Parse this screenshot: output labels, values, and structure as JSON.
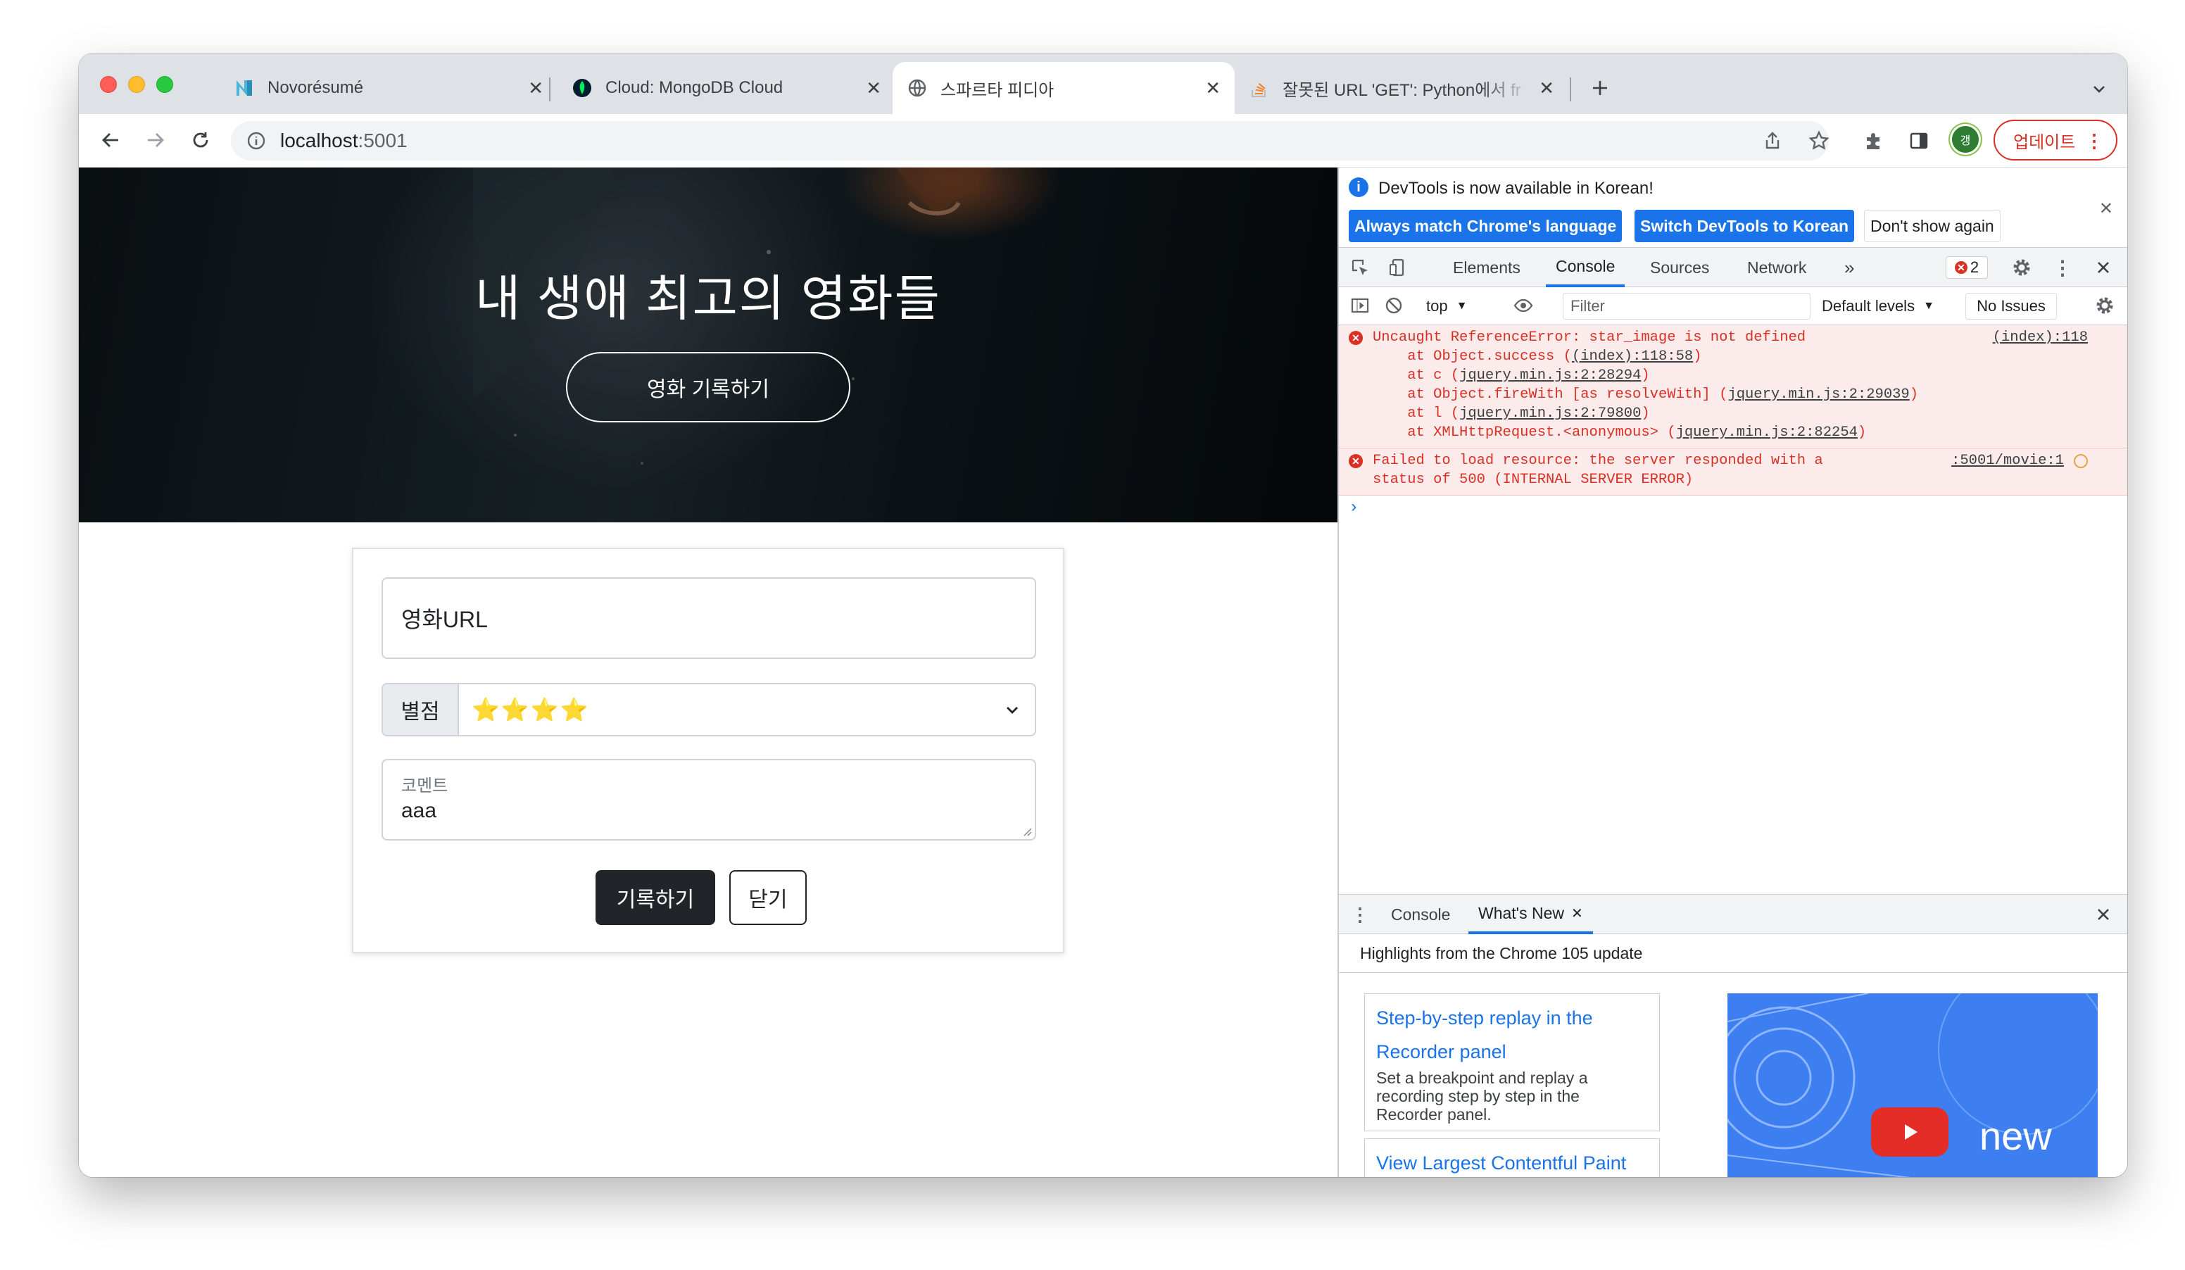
{
  "browser": {
    "tabs": [
      {
        "title": "Novorésumé",
        "active": false
      },
      {
        "title": "Cloud: MongoDB Cloud",
        "active": false
      },
      {
        "title": "스파르타 피디아",
        "active": true
      },
      {
        "title": "잘못된 URL 'GET': Python에서 fr",
        "active": false
      }
    ],
    "url_host": "localhost",
    "url_port": ":5001",
    "profile_initial": "갱",
    "update_label": "업데이트"
  },
  "page": {
    "hero_title": "내 생애 최고의 영화들",
    "hero_button": "영화 기록하기",
    "url_placeholder": "영화URL",
    "rating_label": "별점",
    "rating_value": "⭐⭐⭐⭐",
    "comment_label": "코멘트",
    "comment_value": "aaa",
    "save_button": "기록하기",
    "close_button": "닫기"
  },
  "devtools": {
    "info_text": "DevTools is now available in Korean!",
    "btn_match": "Always match Chrome's language",
    "btn_switch": "Switch DevTools to Korean",
    "btn_dont_show": "Don't show again",
    "tabs": [
      "Elements",
      "Console",
      "Sources",
      "Network"
    ],
    "active_tab": "Console",
    "error_count": "2",
    "context": "top",
    "filter_placeholder": "Filter",
    "levels": "Default levels",
    "issues": "No Issues",
    "console": {
      "err1": {
        "message": "Uncaught ReferenceError: star_image is not defined",
        "source": "(index):118",
        "stack": [
          {
            "text": "    at Object.success (",
            "link": "(index):118:58",
            "end": ")"
          },
          {
            "text": "    at c (",
            "link": "jquery.min.js:2:28294",
            "end": ")"
          },
          {
            "text": "    at Object.fireWith [as resolveWith] (",
            "link": "jquery.min.js:2:29039",
            "end": ")"
          },
          {
            "text": "    at l (",
            "link": "jquery.min.js:2:79800",
            "end": ")"
          },
          {
            "text": "    at XMLHttpRequest.<anonymous> (",
            "link": "jquery.min.js:2:82254",
            "end": ")"
          }
        ]
      },
      "err2": {
        "line1": "Failed to load resource: the server responded with a",
        "line2": "status of 500 (INTERNAL SERVER ERROR)",
        "source": ":5001/movie:1"
      }
    },
    "drawer": {
      "tabs": [
        "Console",
        "What's New"
      ],
      "active_tab": "What's New",
      "highlights": "Highlights from the Chrome 105 update",
      "feature1_title": "Step-by-step replay in the Recorder panel",
      "feature1_desc": "Set a breakpoint and replay a recording step by step in the Recorder panel.",
      "feature2_title": "View Largest Contentful Paint",
      "video_text": "new"
    }
  }
}
